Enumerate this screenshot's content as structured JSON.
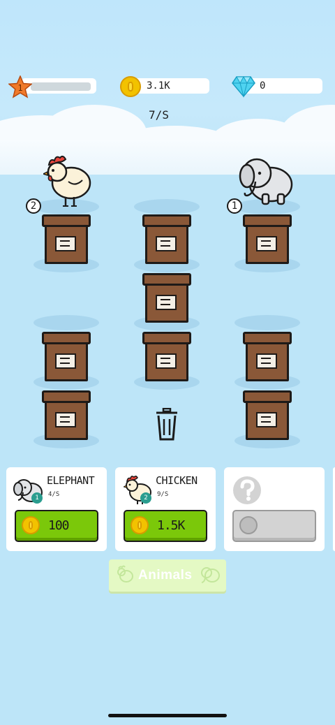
{
  "hud": {
    "level": "1",
    "level_progress": 0.0,
    "coins": "3.1K",
    "gems": "0",
    "income_rate": "7/S"
  },
  "board": {
    "animals": [
      {
        "name": "chicken",
        "level_badge": "2"
      },
      {
        "name": "elephant",
        "level_badge": "1"
      }
    ]
  },
  "shop": {
    "cards": [
      {
        "name": "ELEPHANT",
        "rate": "4/S",
        "price": "100",
        "badge": "1"
      },
      {
        "name": "CHICKEN",
        "rate": "9/S",
        "price": "1.5K",
        "badge": "2"
      },
      {
        "name": "",
        "rate": "",
        "price": "",
        "locked": true
      }
    ],
    "animals_button": "Animals"
  },
  "colors": {
    "sky": "#bfe6fb",
    "box_brown": "#8a5838",
    "buy_green": "#7bc80a",
    "coin_gold": "#f2c200",
    "gem_cyan": "#4fd3f0",
    "star_orange": "#f07a2a"
  },
  "icons": [
    "star-icon",
    "coin-icon",
    "diamond-icon",
    "trash-icon",
    "question-icon",
    "chicken-icon",
    "elephant-icon"
  ]
}
